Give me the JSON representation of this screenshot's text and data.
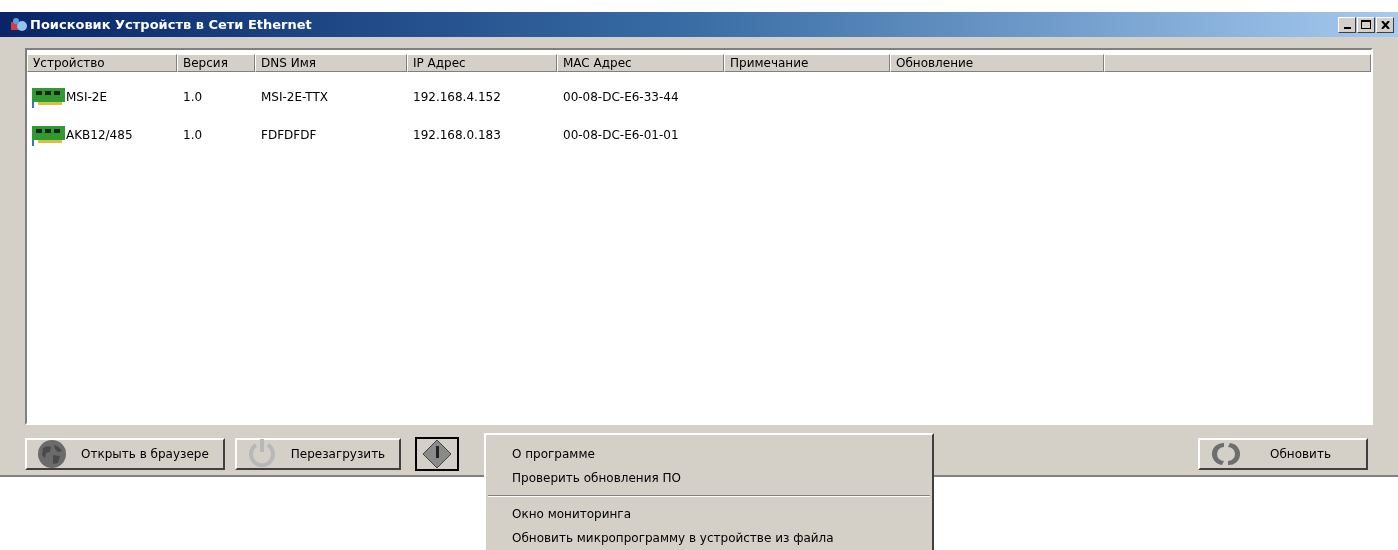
{
  "window": {
    "title": "Поисковик Устройств в Сети Ethernet"
  },
  "table": {
    "columns": [
      "Устройство",
      "Версия",
      "DNS Имя",
      "IP Адрес",
      "MAC Адрес",
      "Примечание",
      "Обновление"
    ],
    "rows": [
      {
        "cells": [
          "MSI-2E",
          "1.0",
          "MSI-2E-TTX",
          "192.168.4.152",
          "00-08-DC-E6-33-44"
        ]
      },
      {
        "cells": [
          "AKB12/485",
          "1.0",
          "FDFDFDF",
          "192.168.0.183",
          "00-08-DC-E6-01-01"
        ]
      }
    ]
  },
  "buttons": [
    {
      "label": "Открыть в браузере",
      "kind": "globe"
    },
    {
      "label": "Перезагрузить",
      "kind": "power"
    }
  ],
  "menu_button": {
    "pressed": true
  },
  "refresh_button": {
    "label": "Обновить"
  },
  "menu": [
    {
      "kind": "item",
      "label": "О программе"
    },
    {
      "kind": "item",
      "label": "Проверить обновления ПО"
    },
    {
      "kind": "separator"
    },
    {
      "kind": "item",
      "label": "Окно мониторинга"
    },
    {
      "kind": "item",
      "label": "Обновить микропрограмму в устройстве из файла"
    }
  ]
}
